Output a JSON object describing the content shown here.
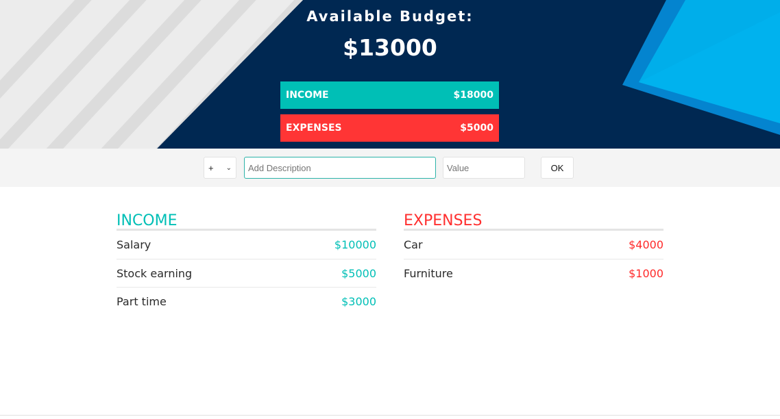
{
  "header": {
    "title": "Available Budget:",
    "budget": "$13000",
    "income_label": "INCOME",
    "income_value": "$18000",
    "expenses_label": "EXPENSES",
    "expenses_value": "$5000"
  },
  "add_bar": {
    "type_value": "+",
    "description_placeholder": "Add Description",
    "value_placeholder": "Value",
    "ok_label": "OK"
  },
  "income": {
    "title": "INCOME",
    "items": [
      {
        "name": "Salary",
        "amount": "$10000"
      },
      {
        "name": "Stock earning",
        "amount": "$5000"
      },
      {
        "name": "Part time",
        "amount": "$3000"
      }
    ]
  },
  "expenses": {
    "title": "EXPENSES",
    "items": [
      {
        "name": "Car",
        "amount": "$4000"
      },
      {
        "name": "Furniture",
        "amount": "$1000"
      }
    ]
  },
  "colors": {
    "header_bg": "#002852",
    "income": "#00bfb6",
    "expenses": "#ff3535",
    "accent_blue": "#00aeea"
  }
}
